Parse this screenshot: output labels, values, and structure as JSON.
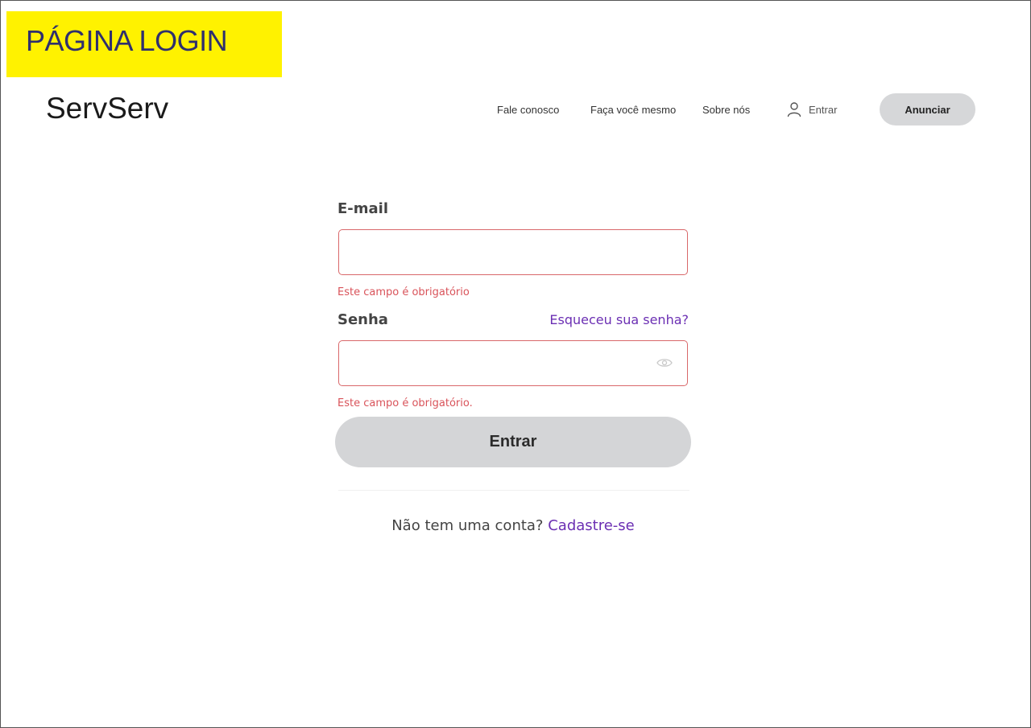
{
  "page_label": "PÁGINA LOGIN",
  "brand": "ServServ",
  "nav": {
    "links": [
      "Fale conosco",
      "Faça você mesmo",
      "Sobre nós"
    ],
    "login_label": "Entrar",
    "login_icon": "user-icon",
    "cta_label": "Anunciar"
  },
  "form": {
    "email": {
      "label": "E-mail",
      "value": "",
      "error": "Este campo é obrigatório"
    },
    "password": {
      "label": "Senha",
      "value": "",
      "forgot_link": "Esqueceu sua senha?",
      "toggle_icon": "eye-icon",
      "error": "Este campo é obrigatório."
    },
    "submit_label": "Entrar",
    "signup_prompt": "Não tem uma conta?",
    "signup_link": "Cadastre-se"
  },
  "colors": {
    "label_highlight": "#fff200",
    "error": "#d9535a",
    "input_border_error": "#d9686a",
    "link": "#6b2fb3",
    "button_bg": "#d4d5d7"
  }
}
